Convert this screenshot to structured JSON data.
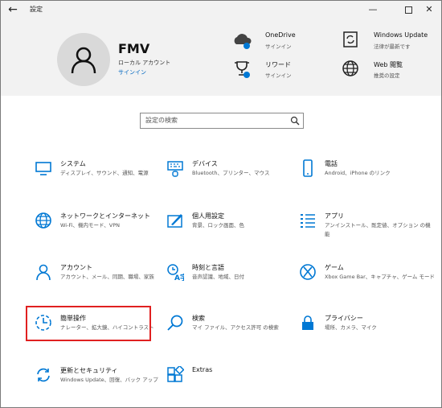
{
  "window": {
    "title": "設定",
    "back_glyph": "←",
    "minimize_glyph": "—",
    "close_glyph": "✕"
  },
  "account": {
    "name": "FMV",
    "type": "ローカル アカウント",
    "signin_link": "サインイン"
  },
  "header_items": [
    {
      "title": "OneDrive",
      "subtitle": "サインイン",
      "icon": "cloud-icon"
    },
    {
      "title": "Windows Update",
      "subtitle": "法律が最新です",
      "icon": "update-icon"
    },
    {
      "title": "リワード",
      "subtitle": "サインイン",
      "icon": "trophy-icon"
    },
    {
      "title": "Web 閲覧",
      "subtitle": "推奨の設定",
      "icon": "globe-icon"
    }
  ],
  "search": {
    "placeholder": "設定の検索"
  },
  "tiles": [
    {
      "title": "システム",
      "subtitle": "ディスプレイ、サウンド、通知、電源",
      "icon": "monitor-icon"
    },
    {
      "title": "デバイス",
      "subtitle": "Bluetooth、プリンター、マウス",
      "icon": "keyboard-icon"
    },
    {
      "title": "電話",
      "subtitle": "Android、iPhone のリンク",
      "icon": "phone-icon"
    },
    {
      "title": "ネットワークとインターネット",
      "subtitle": "Wi-Fi、機内モード、VPN",
      "icon": "globe-icon"
    },
    {
      "title": "個人用設定",
      "subtitle": "背景、ロック画面、色",
      "icon": "paint-icon"
    },
    {
      "title": "アプリ",
      "subtitle": "アンインストール、既定値、オプション の機能",
      "icon": "apps-list-icon"
    },
    {
      "title": "アカウント",
      "subtitle": "アカウント、メール、同期、職場、家族",
      "icon": "person-icon"
    },
    {
      "title": "時刻と言語",
      "subtitle": "音声認識、地域、日付",
      "icon": "time-language-icon"
    },
    {
      "title": "ゲーム",
      "subtitle": "Xbox Game Bar、キャプチャ、ゲーム モード",
      "icon": "xbox-icon"
    },
    {
      "title": "簡単操作",
      "subtitle": "ナレーター、拡大鏡、ハイコントラスト",
      "icon": "ease-of-access-icon"
    },
    {
      "title": "検索",
      "subtitle": "マイ ファイル、アクセス許可 の検索",
      "icon": "search-icon"
    },
    {
      "title": "プライバシー",
      "subtitle": "場所、カメラ、マイク",
      "icon": "lock-icon"
    },
    {
      "title": "更新とセキュリティ",
      "subtitle": "Windows Update、回復、バック アップ",
      "icon": "sync-icon"
    },
    {
      "title": "Extras",
      "subtitle": "",
      "icon": "extras-icon"
    }
  ],
  "colors": {
    "accent": "#0078d4",
    "link": "#0067c0",
    "highlight_border": "#e02020",
    "header_bg": "#f2f2f2"
  }
}
